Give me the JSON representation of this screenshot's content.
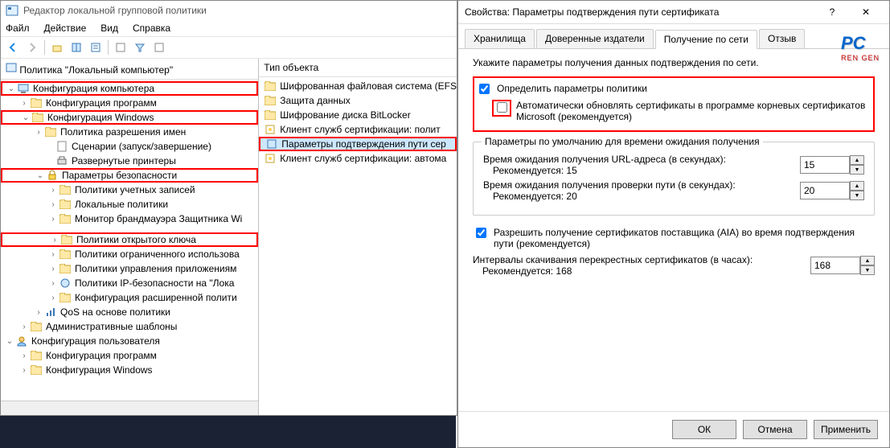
{
  "gpedit": {
    "title": "Редактор локальной групповой политики",
    "menu": {
      "file": "Файл",
      "action": "Действие",
      "view": "Вид",
      "help": "Справка"
    },
    "rootHeader": "Политика \"Локальный компьютер\"",
    "tree": {
      "computerConfig": "Конфигурация компьютера",
      "softwareConfig": "Конфигурация программ",
      "windowsConfig": "Конфигурация Windows",
      "nameResPolicy": "Политика разрешения имен",
      "scripts": "Сценарии (запуск/завершение)",
      "deployedPrinters": "Развернутые принтеры",
      "securitySettings": "Параметры безопасности",
      "accountPolicies": "Политики учетных записей",
      "localPolicies": "Локальные политики",
      "defenderFw": "Монитор брандмауэра Защитника Wi",
      "pkPolicies": "Политики открытого ключа",
      "softwareRestrict": "Политики ограниченного использова",
      "appControl": "Политики управления приложениям",
      "ipsec": "Политики IP-безопасности на \"Лока",
      "extAudit": "Конфигурация расширенной полити",
      "qos": "QoS на основе политики",
      "adminTemplates": "Административные шаблоны",
      "userConfig": "Конфигурация пользователя",
      "userSoftware": "Конфигурация программ",
      "userWindows": "Конфигурация Windows"
    },
    "listHeader": "Тип объекта",
    "list": {
      "efs": "Шифрованная файловая система (EFS",
      "dataProt": "Защита данных",
      "bitlocker": "Шифрование диска BitLocker",
      "certClientPol": "Клиент служб сертификации: полит",
      "certPathValidation": "Параметры подтверждения пути сер",
      "certClientAuto": "Клиент служб сертификации: автома"
    }
  },
  "dlg": {
    "title": "Свойства: Параметры подтверждения пути сертификата",
    "tabs": {
      "stores": "Хранилища",
      "trusted": "Доверенные издатели",
      "network": "Получение по сети",
      "revocation": "Отзыв"
    },
    "desc": "Укажите параметры получения данных подтверждения по сети.",
    "definePolicy": "Определить параметры политики",
    "autoUpdate": "Автоматически обновлять сертификаты в программе корневых сертификатов Microsoft (рекомендуется)",
    "groupTitle": "Параметры по умолчанию для времени ожидания получения",
    "urlTimeoutLabel": "Время ожидания получения URL-адреса (в секундах):",
    "urlTimeoutRec": "Рекомендуется: 15",
    "urlTimeoutValue": "15",
    "pathTimeoutLabel": "Время ожидания получения проверки пути (в секундах):",
    "pathTimeoutRec": "Рекомендуется: 20",
    "pathTimeoutValue": "20",
    "allowAia": "Разрешить получение сертификатов поставщика (AIA) во время подтверждения пути (рекомендуется)",
    "crossIntervalLabel": "Интервалы скачивания перекрестных сертификатов (в часах):",
    "crossIntervalRec": "Рекомендуется: 168",
    "crossIntervalValue": "168",
    "buttons": {
      "ok": "ОК",
      "cancel": "Отмена",
      "apply": "Применить"
    }
  },
  "logo": {
    "top": "PC",
    "bottom": "REN GEN"
  }
}
